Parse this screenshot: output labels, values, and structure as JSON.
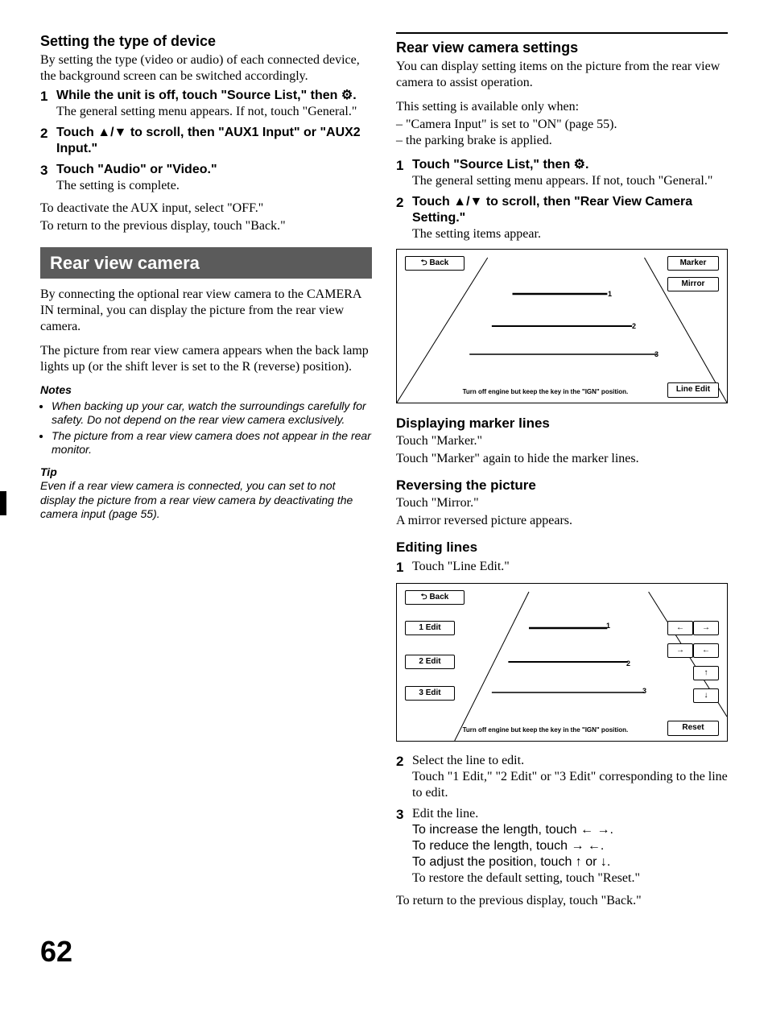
{
  "left": {
    "h1": "Setting the type of device",
    "p1": "By setting the type (video or audio) of each connected device, the background screen can be switched accordingly.",
    "steps": [
      {
        "lead": "While the unit is off, touch \"Source List,\" then ",
        "icon": "⚙.",
        "body": "The general setting menu appears. If not, touch \"General.\""
      },
      {
        "lead": "Touch ▲/▼ to scroll, then \"AUX1 Input\" or \"AUX2 Input.\"",
        "body": ""
      },
      {
        "lead": "Touch \"Audio\" or \"Video.\"",
        "body": "The setting is complete."
      }
    ],
    "p2a": "To deactivate the AUX input, select \"OFF.\"",
    "p2b": "To return to the previous display, touch \"Back.\"",
    "sectionBar": "Rear view camera",
    "p3": "By connecting the optional rear view camera to the CAMERA IN terminal, you can display the picture from the rear view camera.",
    "p4": "The picture from rear view camera appears when the back lamp lights up (or the shift lever is set to the R (reverse) position).",
    "notesH": "Notes",
    "notes": [
      "When backing up your car, watch the surroundings carefully for safety. Do not depend on the rear view camera exclusively.",
      "The picture from a rear view camera does not appear in the rear monitor."
    ],
    "tipH": "Tip",
    "tip": "Even if a rear view camera is connected, you can set to not display the picture from a rear view camera by deactivating the camera input (page 55)."
  },
  "right": {
    "h1": "Rear view camera settings",
    "p1": "You can display setting items on the picture from the rear view camera to assist operation.",
    "p2": "This setting is available only when:",
    "conds": [
      "\"Camera Input\" is set to \"ON\" (page 55).",
      "the parking brake is applied."
    ],
    "steps1": [
      {
        "lead": "Touch \"Source List,\" then ",
        "icon": "⚙.",
        "body": "The general setting menu appears. If not, touch \"General.\""
      },
      {
        "lead": "Touch ▲/▼ to scroll, then \"Rear View Camera Setting.\"",
        "body": "The setting items appear."
      }
    ],
    "ss1": {
      "back": "Back",
      "marker": "Marker",
      "mirror": "Mirror",
      "lineEdit": "Line Edit",
      "l1": "1",
      "l2": "2",
      "l3": "3",
      "caption": "Turn off engine but keep the key in the \"IGN\" position."
    },
    "h2": "Displaying marker lines",
    "p3a": "Touch \"Marker.\"",
    "p3b": "Touch \"Marker\" again to hide the marker lines.",
    "h3": "Reversing the picture",
    "p4a": "Touch \"Mirror.\"",
    "p4b": "A mirror reversed picture appears.",
    "h4": "Editing lines",
    "steps2_1": "Touch \"Line Edit.\"",
    "ss2": {
      "back": "Back",
      "e1": "1 Edit",
      "e2": "2 Edit",
      "e3": "3 Edit",
      "l1": "1",
      "l2": "2",
      "l3": "3",
      "reset": "Reset",
      "caption": "Turn off engine but keep the key in the \"IGN\" position."
    },
    "steps2_2_lead": "Select the line to edit.",
    "steps2_2_body": "Touch \"1 Edit,\" \"2 Edit\" or \"3 Edit\" corresponding to the line to edit.",
    "steps2_3_lead": "Edit the line.",
    "steps2_3_b1": "To increase the length, touch ← →.",
    "steps2_3_b2": "To reduce the length, touch → ←.",
    "steps2_3_b3": "To adjust the position, touch ↑ or ↓.",
    "steps2_3_b4": "To restore the default setting, touch \"Reset.\"",
    "pLast": "To return to the previous display, touch \"Back.\""
  },
  "pageNum": "62"
}
